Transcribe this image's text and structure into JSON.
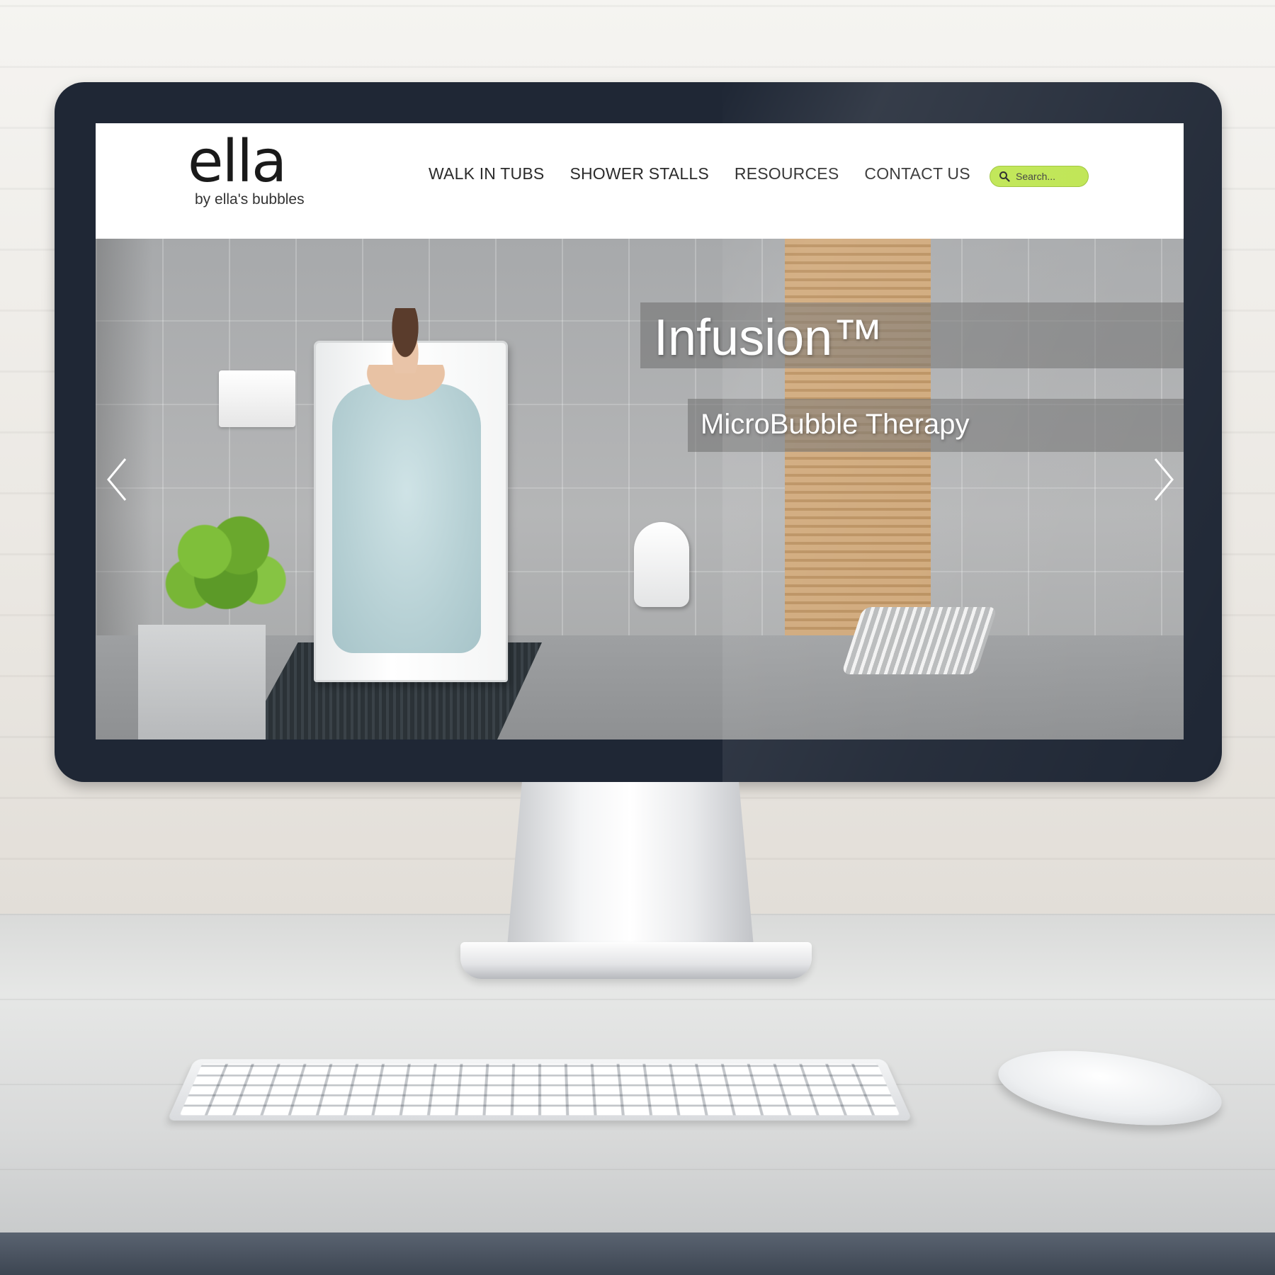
{
  "site": {
    "logo": {
      "wordmark": "ella",
      "tagline": "by ella's bubbles"
    },
    "nav": {
      "items": [
        {
          "label": "WALK IN TUBS"
        },
        {
          "label": "SHOWER STALLS"
        },
        {
          "label": "RESOURCES"
        },
        {
          "label": "CONTACT US"
        }
      ]
    },
    "search": {
      "placeholder": "Search...",
      "icon": "search-icon",
      "accent_color": "#bde54e"
    },
    "hero": {
      "title": "Infusion™",
      "subtitle": "MicroBubble Therapy",
      "prev_icon": "chevron-left-icon",
      "next_icon": "chevron-right-icon"
    }
  },
  "colors": {
    "bezel": "#1f2735",
    "nav_text": "#2b2b2b",
    "caption_text": "#ffffff"
  }
}
